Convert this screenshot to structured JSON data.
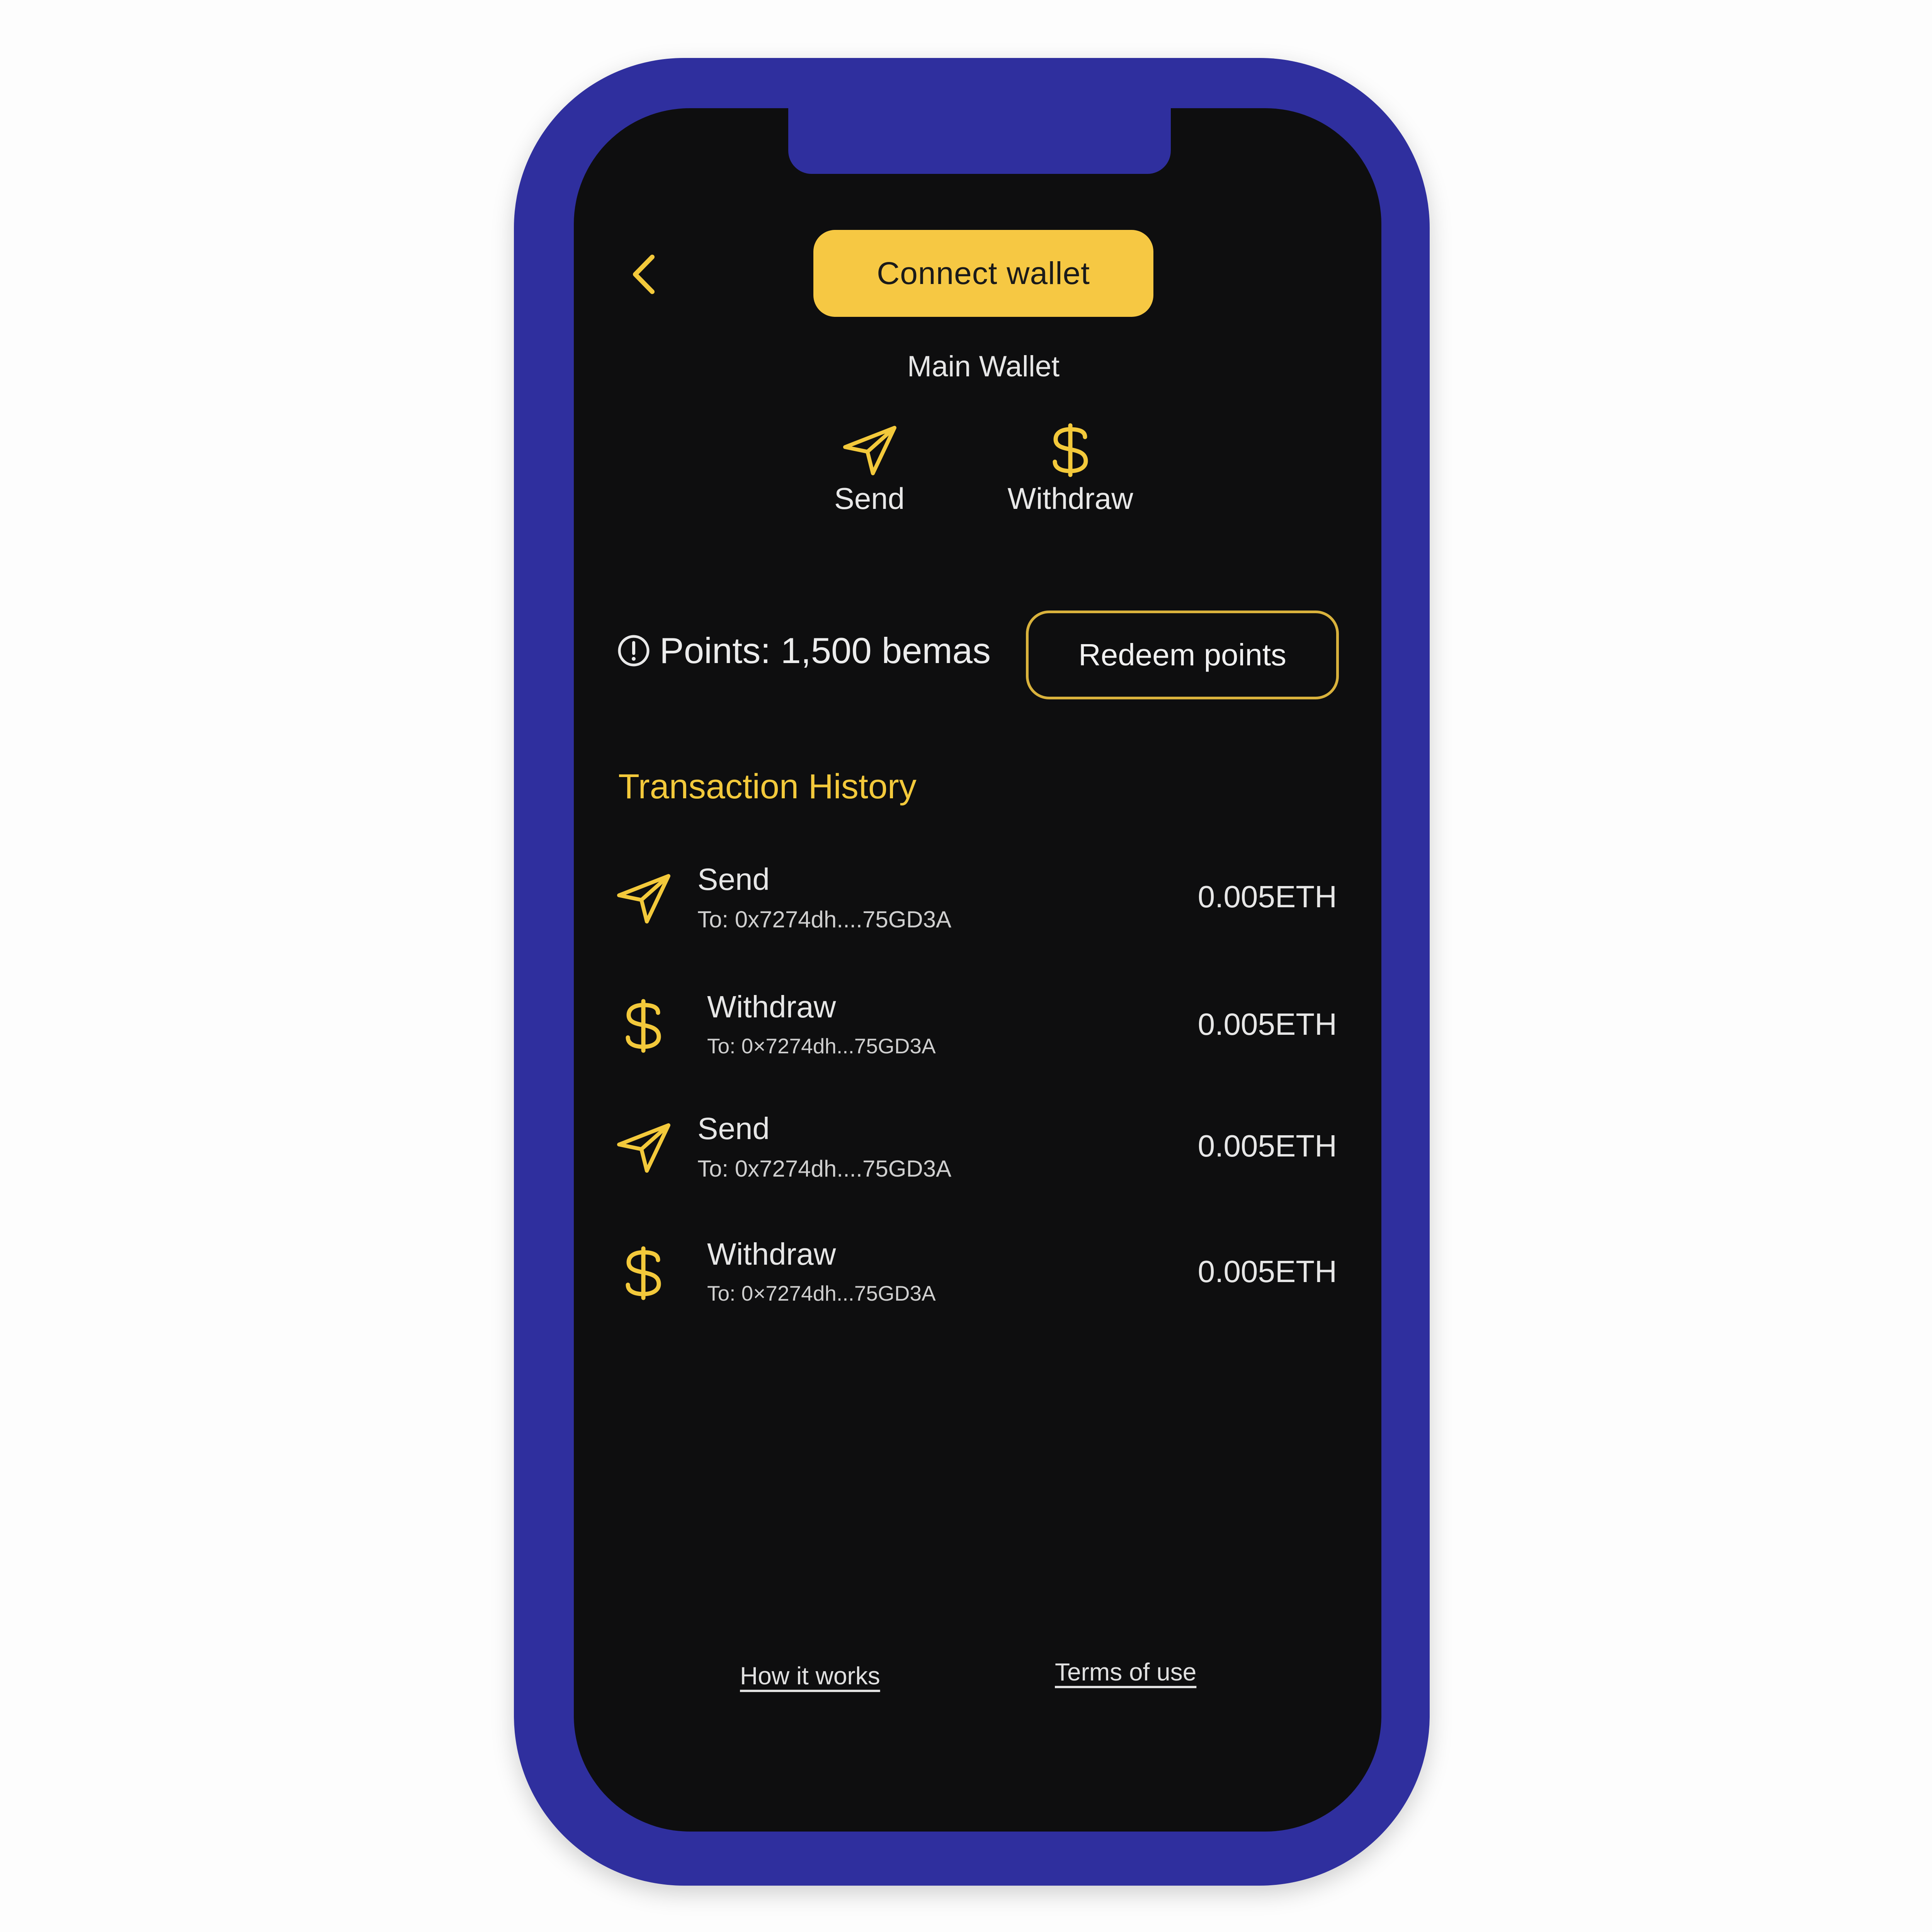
{
  "header": {
    "back_icon": "chevron-left-icon",
    "connect_wallet_label": "Connect wallet",
    "wallet_title": "Main Wallet"
  },
  "actions": [
    {
      "label": "Send",
      "icon": "send-icon"
    },
    {
      "label": "Withdraw",
      "icon": "dollar-icon"
    }
  ],
  "points": {
    "icon": "info-icon",
    "text": "Points: 1,500 bemas",
    "redeem_label": "Redeem points"
  },
  "history": {
    "title": "Transaction History",
    "items": [
      {
        "type": "Send",
        "address": "To: 0x7274dh....75GD3A",
        "amount": "0.005ETH",
        "icon": "send-icon"
      },
      {
        "type": "Withdraw",
        "address": "To: 0×7274dh...75GD3A",
        "amount": "0.005ETH",
        "icon": "dollar-icon"
      },
      {
        "type": "Send",
        "address": "To: 0x7274dh....75GD3A",
        "amount": "0.005ETH",
        "icon": "send-icon"
      },
      {
        "type": "Withdraw",
        "address": "To: 0×7274dh...75GD3A",
        "amount": "0.005ETH",
        "icon": "dollar-icon"
      }
    ]
  },
  "footer": {
    "how_it_works": "How it works",
    "terms_of_use": "Terms of use"
  },
  "colors": {
    "accent": "#f3c93b",
    "button": "#f6c843",
    "background": "#0e0e0f",
    "phone_frame": "#2f2f9e"
  }
}
